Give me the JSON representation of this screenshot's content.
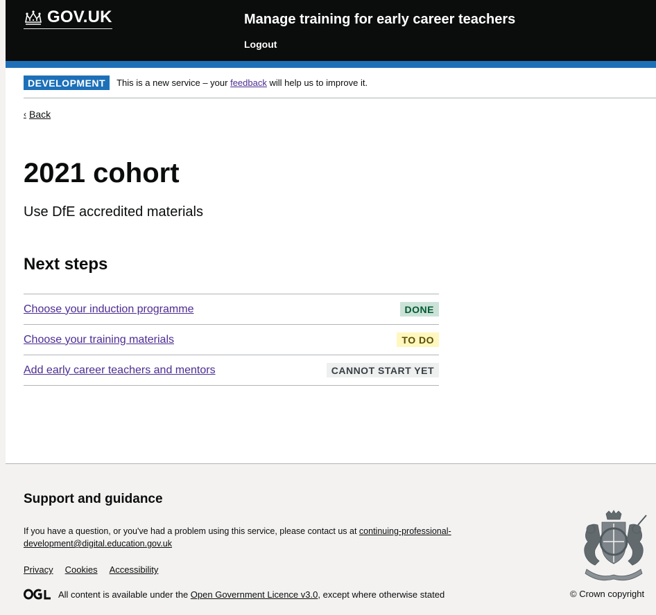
{
  "header": {
    "logo_text": "GOV.UK",
    "service_name": "Manage training for early career teachers",
    "logout_label": "Logout"
  },
  "phase_banner": {
    "tag": "DEVELOPMENT",
    "text_before": "This is a new service – your ",
    "link": "feedback",
    "text_after": " will help us to improve it."
  },
  "back_link": "Back",
  "main": {
    "title": "2021 cohort",
    "subtitle": "Use DfE accredited materials",
    "next_steps_heading": "Next steps",
    "tasks": [
      {
        "label": "Choose your induction programme",
        "status": "DONE",
        "status_color": "#cce2d8"
      },
      {
        "label": "Choose your training materials",
        "status": "TO DO",
        "status_color": "#fff7bf"
      },
      {
        "label": "Add early career teachers and mentors",
        "status": "CANNOT START YET",
        "status_color": "#eeefef"
      }
    ]
  },
  "footer": {
    "heading": "Support and guidance",
    "support_text": "If you have a question, or you've had a problem using this service, please contact us at ",
    "support_email": "continuing-professional-development@digital.education.gov.uk",
    "links": [
      "Privacy",
      "Cookies",
      "Accessibility"
    ],
    "licence_before": "All content is available under the ",
    "licence_link": "Open Government Licence v3.0",
    "licence_after": ", except where otherwise stated",
    "copyright": "© Crown copyright"
  },
  "colors": {
    "header_bg": "#0b0c0c",
    "header_accent": "#1d70b8",
    "link": "#4c2c92",
    "footer_bg": "#f3f2f1"
  }
}
